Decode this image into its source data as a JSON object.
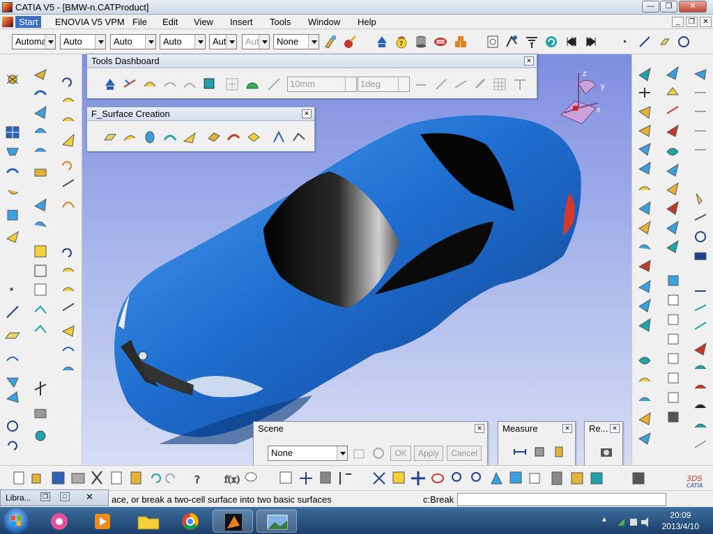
{
  "window": {
    "title": "CATIA V5 - [BMW-n.CATProduct]",
    "minimize": "—",
    "restore": "❐",
    "close": "✕"
  },
  "menubar": {
    "items": [
      "Start",
      "ENOVIA V5 VPM",
      "File",
      "Edit",
      "View",
      "Insert",
      "Tools",
      "Window",
      "Help"
    ],
    "doc_min": "_",
    "doc_restore": "❐",
    "doc_close": "✕"
  },
  "toolbar": {
    "combos": [
      "Automa",
      "Auto",
      "Auto",
      "Auto",
      "Aut",
      "Aut",
      "None"
    ]
  },
  "tools_dashboard": {
    "title": "Tools Dashboard",
    "close": "✕",
    "distance": "10mm",
    "angle": "1deg"
  },
  "surface_creation": {
    "title": "F_Surface Creation",
    "close": "✕"
  },
  "compass": {
    "x": "x",
    "y": "y",
    "z": "z"
  },
  "scene": {
    "title": "Scene",
    "close": "✕",
    "value": "None",
    "ok": "OK",
    "apply": "Apply",
    "cancel": "Cancel"
  },
  "measure": {
    "title": "Measure",
    "close": "✕"
  },
  "render": {
    "title": "Re...",
    "close": "✕"
  },
  "status": {
    "library_tab": "Libra...",
    "message": "ace, or break a two-cell surface into two basic surfaces",
    "command_label": "c:Break",
    "command_value": ""
  },
  "taskbar": {
    "time": "20:09",
    "date": "2013/4/10"
  },
  "colors": {
    "car_body": "#1f6fd1",
    "viewport_top": "#7e8ee0",
    "viewport_bottom": "#d6ddf4",
    "taskbar": "#2a5383"
  }
}
